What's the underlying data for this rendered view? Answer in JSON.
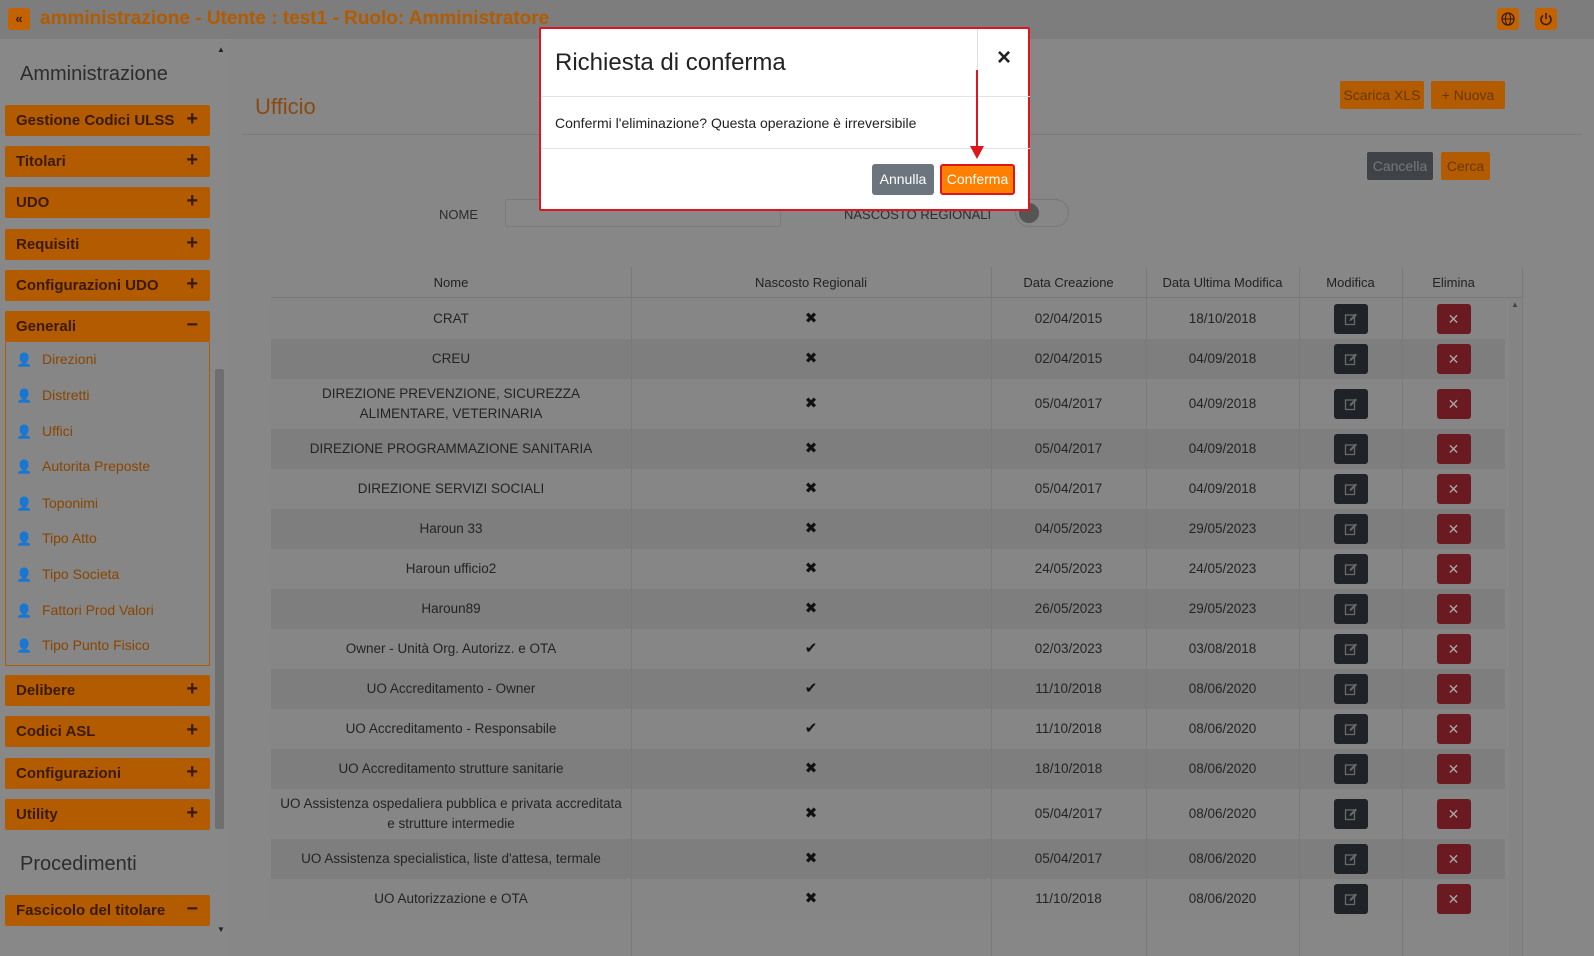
{
  "header": {
    "title": "amministrazione - Utente : test1 - Ruolo: Amministratore",
    "icons": [
      "collapse-icon",
      "globe-icon",
      "power-icon"
    ]
  },
  "sidebar": {
    "section1": "Amministrazione",
    "menu_top": [
      {
        "label": "Gestione Codici ULSS",
        "sign": "+"
      },
      {
        "label": "Titolari",
        "sign": "+"
      },
      {
        "label": "UDO",
        "sign": "+"
      },
      {
        "label": "Requisiti",
        "sign": "+"
      },
      {
        "label": "Configurazioni UDO",
        "sign": "+"
      },
      {
        "label": "Generali",
        "sign": "−"
      }
    ],
    "submenu": [
      "Direzioni",
      "Distretti",
      "Uffici",
      "Autorita Preposte",
      "Toponimi",
      "Tipo Atto",
      "Tipo Societa",
      "Fattori Prod Valori",
      "Tipo Punto Fisico"
    ],
    "menu_bottom": [
      {
        "label": "Delibere",
        "sign": "+"
      },
      {
        "label": "Codici ASL",
        "sign": "+"
      },
      {
        "label": "Configurazioni",
        "sign": "+"
      },
      {
        "label": "Utility",
        "sign": "+"
      }
    ],
    "section2": "Procedimenti",
    "menu_proc": [
      {
        "label": "Fascicolo del titolare",
        "sign": "−"
      }
    ]
  },
  "page": {
    "title": "Ufficio",
    "download_label": "Scarica XLS",
    "new_label": "Nuova",
    "clear_label": "Cancella",
    "search_label": "Cerca",
    "filter_name_label": "NOME",
    "filter_hidden_label": "NASCOSTO REGIONALI",
    "filter_name_value": ""
  },
  "table": {
    "headers": [
      "Nome",
      "Nascosto Regionali",
      "Data Creazione",
      "Data Ultima Modifica",
      "Modifica",
      "Elimina"
    ],
    "rows": [
      {
        "name": "CRAT",
        "hidden": false,
        "created": "02/04/2015",
        "modified": "18/10/2018"
      },
      {
        "name": "CREU",
        "hidden": false,
        "created": "02/04/2015",
        "modified": "04/09/2018"
      },
      {
        "name": "DIREZIONE PREVENZIONE, SICUREZZA ALIMENTARE, VETERINARIA",
        "hidden": false,
        "created": "05/04/2017",
        "modified": "04/09/2018"
      },
      {
        "name": "DIREZIONE PROGRAMMAZIONE SANITARIA",
        "hidden": false,
        "created": "05/04/2017",
        "modified": "04/09/2018"
      },
      {
        "name": "DIREZIONE SERVIZI SOCIALI",
        "hidden": false,
        "created": "05/04/2017",
        "modified": "04/09/2018"
      },
      {
        "name": "Haroun 33",
        "hidden": false,
        "created": "04/05/2023",
        "modified": "29/05/2023"
      },
      {
        "name": "Haroun ufficio2",
        "hidden": false,
        "created": "24/05/2023",
        "modified": "24/05/2023"
      },
      {
        "name": "Haroun89",
        "hidden": false,
        "created": "26/05/2023",
        "modified": "29/05/2023"
      },
      {
        "name": "Owner - Unità Org. Autorizz. e OTA",
        "hidden": true,
        "created": "02/03/2023",
        "modified": "03/08/2018"
      },
      {
        "name": "UO Accreditamento - Owner",
        "hidden": true,
        "created": "11/10/2018",
        "modified": "08/06/2020"
      },
      {
        "name": "UO Accreditamento - Responsabile",
        "hidden": true,
        "created": "11/10/2018",
        "modified": "08/06/2020"
      },
      {
        "name": "UO Accreditamento strutture sanitarie",
        "hidden": false,
        "created": "18/10/2018",
        "modified": "08/06/2020"
      },
      {
        "name": "UO Assistenza ospedaliera pubblica e privata accreditata e strutture intermedie",
        "hidden": false,
        "created": "05/04/2017",
        "modified": "08/06/2020"
      },
      {
        "name": "UO Assistenza specialistica, liste d'attesa, termale",
        "hidden": false,
        "created": "05/04/2017",
        "modified": "08/06/2020"
      },
      {
        "name": "UO Autorizzazione e OTA",
        "hidden": false,
        "created": "11/10/2018",
        "modified": "08/06/2020"
      }
    ]
  },
  "modal": {
    "title": "Richiesta di conferma",
    "close": "×",
    "body": "Confermi l'eliminazione? Questa operazione è irreversibile",
    "cancel_label": "Annulla",
    "confirm_label": "Conferma"
  },
  "colors": {
    "accent": "#ff7f00",
    "highlight": "#e0141e",
    "cancel": "#6c757d"
  }
}
